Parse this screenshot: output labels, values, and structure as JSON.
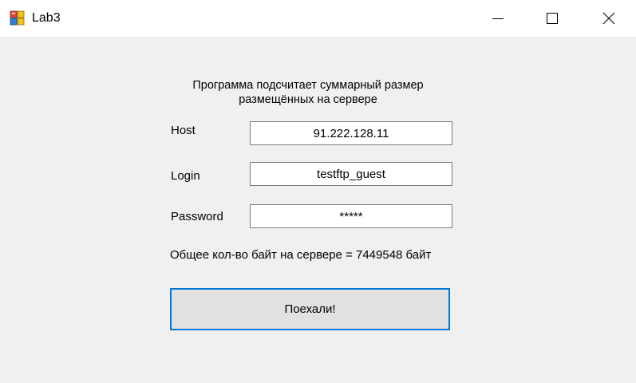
{
  "window": {
    "title": "Lab3",
    "app_icon": "windows-forms-app-icon",
    "controls": {
      "minimize_icon": "minimize-icon",
      "maximize_icon": "maximize-icon",
      "close_icon": "close-icon"
    }
  },
  "form": {
    "caption": "Программа подсчитает суммарный размер размещённых на сервере",
    "host": {
      "label": "Host",
      "value": "91.222.128.11"
    },
    "login": {
      "label": "Login",
      "value": "testftp_guest"
    },
    "password": {
      "label": "Password",
      "value": "*****"
    },
    "result": "Общее кол-во байт на сервере = 7449548 байт",
    "go_button": "Поехали!"
  },
  "colors": {
    "title_bar": "#ffffff",
    "client_background": "#f0f0f0",
    "input_border": "#7a7a7a",
    "button_focus_border": "#0078d7",
    "button_background": "#e1e1e1"
  }
}
